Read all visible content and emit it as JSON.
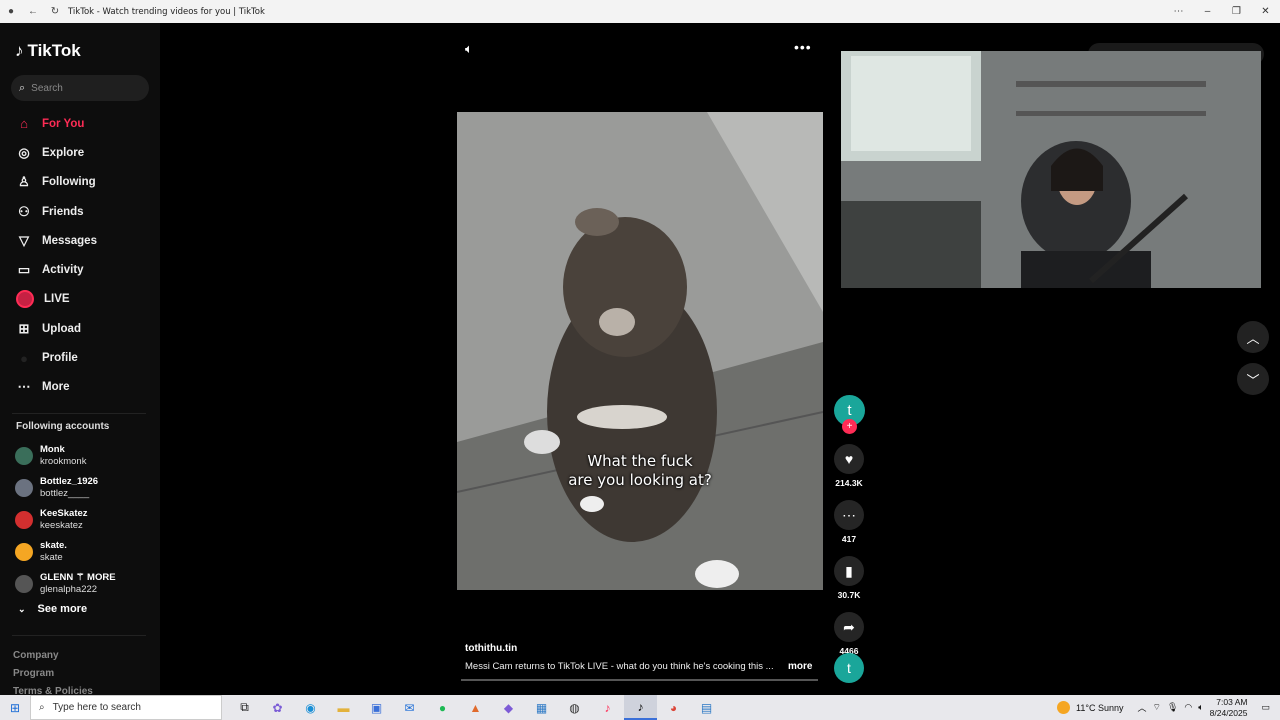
{
  "window": {
    "title": "TikTok - Watch trending videos for you | TikTok"
  },
  "sidebar": {
    "logo_text": "TikTok",
    "search_placeholder": "Search",
    "nav": [
      {
        "label": "For You",
        "icon": "home-icon",
        "active": true
      },
      {
        "label": "Explore",
        "icon": "compass-icon"
      },
      {
        "label": "Following",
        "icon": "user-icon"
      },
      {
        "label": "Friends",
        "icon": "users-icon"
      },
      {
        "label": "Messages",
        "icon": "send-icon"
      },
      {
        "label": "Activity",
        "icon": "message-square-icon"
      },
      {
        "label": "LIVE",
        "icon": "live-icon"
      },
      {
        "label": "Upload",
        "icon": "plus-square-icon"
      },
      {
        "label": "Profile",
        "icon": "profile-avatar-icon"
      },
      {
        "label": "More",
        "icon": "more-dots-icon"
      }
    ],
    "following_header": "Following accounts",
    "accounts": [
      {
        "name": "Monk",
        "handle": "krookmonk",
        "color": "#3a6e5a"
      },
      {
        "name": "Bottlez_1926",
        "handle": "bottlez____",
        "color": "#6b7280"
      },
      {
        "name": "KeeSkatez",
        "handle": "keeskatez",
        "color": "#d32f2f"
      },
      {
        "name": "skate.",
        "handle": "skate",
        "color": "#f5a623"
      },
      {
        "name": "GLENN ⚚ MORE",
        "handle": "glenalpha222",
        "color": "#555555"
      }
    ],
    "see_more": "See more",
    "footer_links": [
      "Company",
      "Program",
      "Terms & Policies"
    ]
  },
  "video": {
    "caption_line1": "What the fuck",
    "caption_line2": "are you looking at?",
    "author": "tothithu.tin",
    "description": "Messi Cam returns to TikTok LIVE - what do you think he's cooking this ...",
    "more_label": "more",
    "creator_initial": "t",
    "likes": "214.3K",
    "comments": "417",
    "saves": "30.7K",
    "shares": "4466"
  },
  "taskbar": {
    "search_placeholder": "Type here to search",
    "weather": "11°C  Sunny",
    "time": "7:03 AM",
    "date": "8/24/2025"
  },
  "colors": {
    "accent": "#fe2c55",
    "avatar_teal": "#1aa69a"
  }
}
